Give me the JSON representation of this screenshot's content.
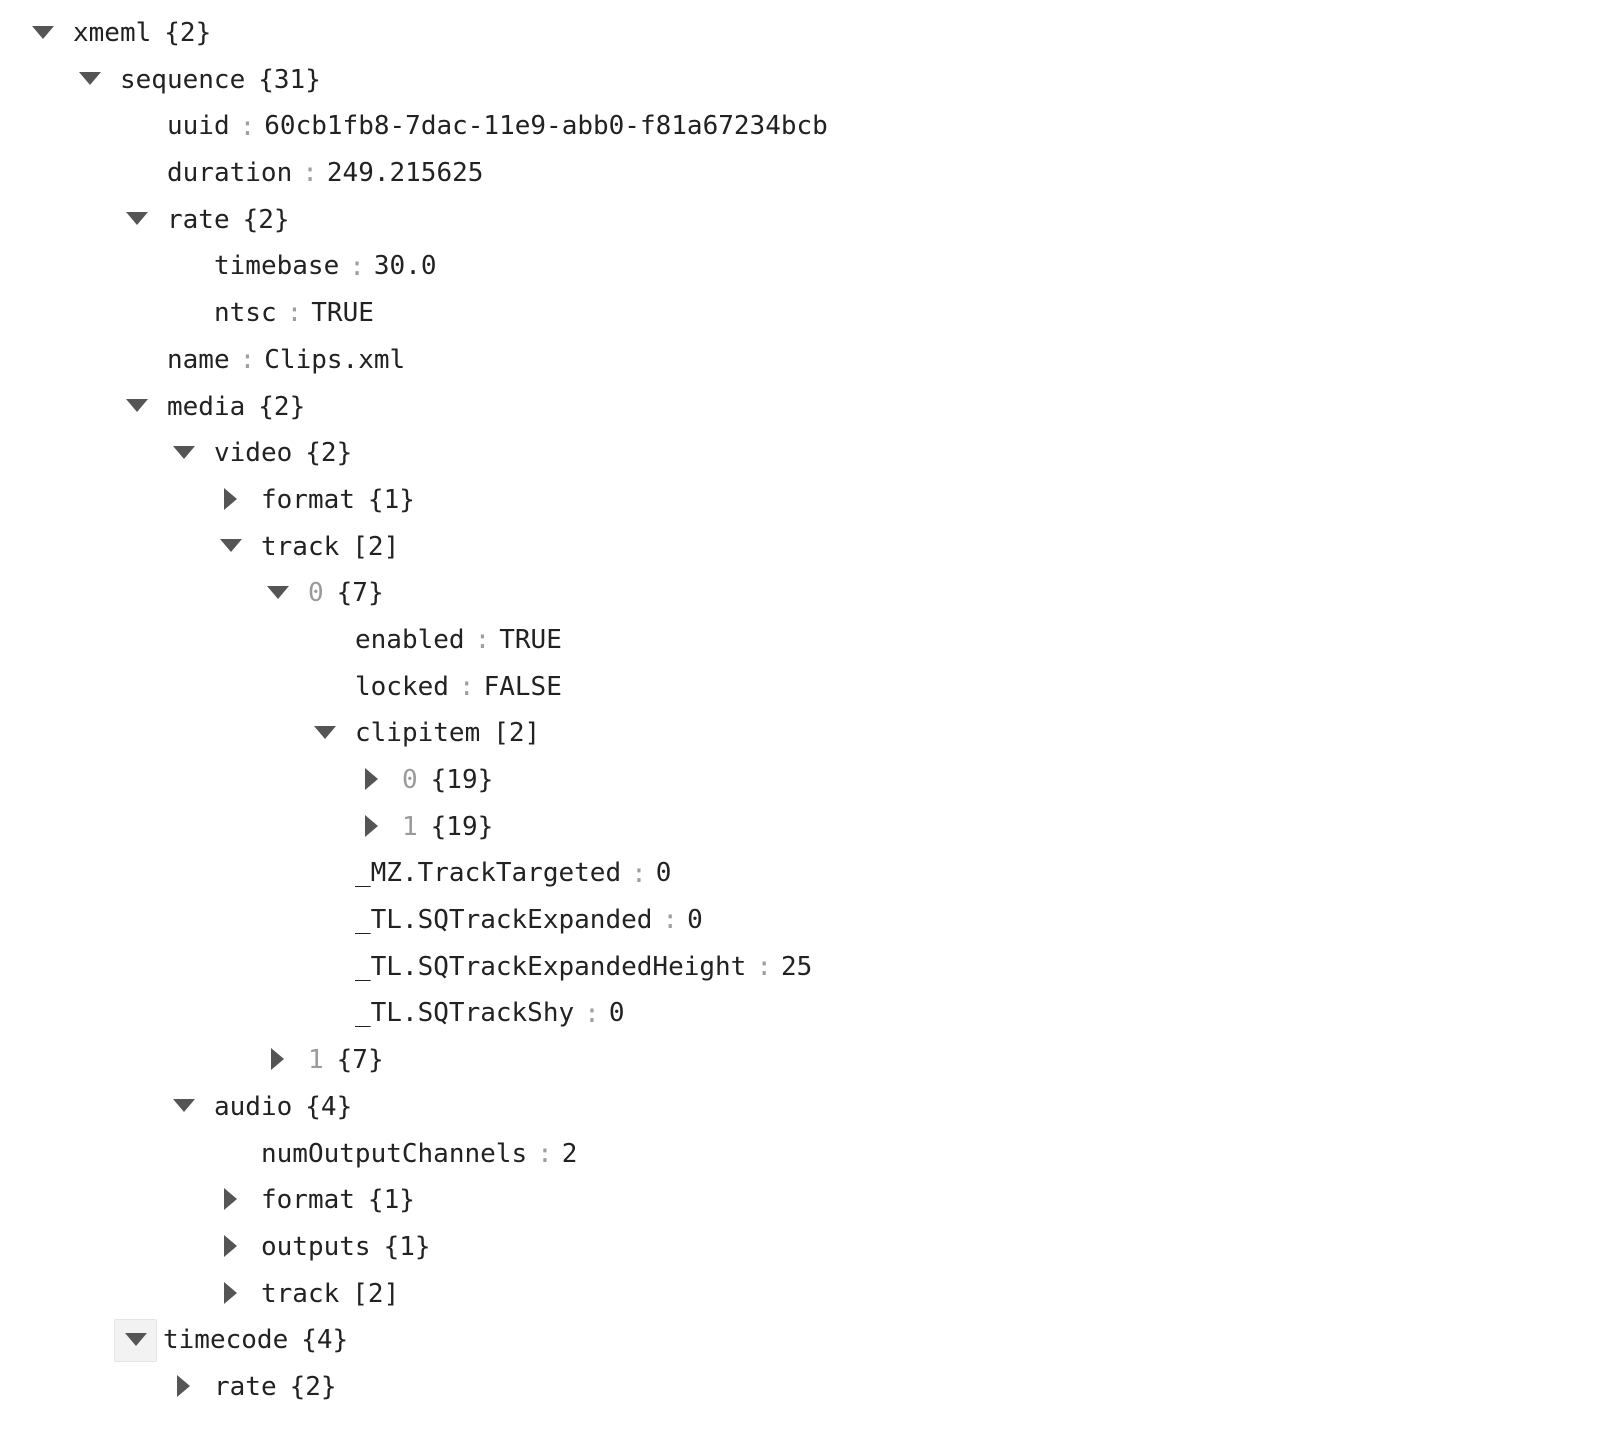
{
  "viewer": {
    "type": "json-tree",
    "root_label": "xmeml",
    "background_color": "#ffffff",
    "text_color": "#222222",
    "muted_color": "#9a9a9a",
    "arrow_color": "#555555",
    "highlight_fill": "#f2f2f2",
    "highlight_border": "#e4e4e4",
    "glyphs": {
      "expanded": "triangle-down",
      "collapsed": "triangle-right"
    }
  },
  "rows": [
    {
      "depth": 0,
      "toggle": "expanded",
      "key": "xmeml",
      "key_kind": "name",
      "count": "{2}"
    },
    {
      "depth": 1,
      "toggle": "expanded",
      "key": "sequence",
      "key_kind": "name",
      "count": "{31}"
    },
    {
      "depth": 2,
      "toggle": "none",
      "key": "uuid",
      "key_kind": "name",
      "colon": ":",
      "value": "60cb1fb8-7dac-11e9-abb0-f81a67234bcb"
    },
    {
      "depth": 2,
      "toggle": "none",
      "key": "duration",
      "key_kind": "name",
      "colon": ":",
      "value": "249.215625"
    },
    {
      "depth": 2,
      "toggle": "expanded",
      "key": "rate",
      "key_kind": "name",
      "count": "{2}"
    },
    {
      "depth": 3,
      "toggle": "none",
      "key": "timebase",
      "key_kind": "name",
      "colon": ":",
      "value": "30.0"
    },
    {
      "depth": 3,
      "toggle": "none",
      "key": "ntsc",
      "key_kind": "name",
      "colon": ":",
      "value": "TRUE"
    },
    {
      "depth": 2,
      "toggle": "none",
      "key": "name",
      "key_kind": "name",
      "colon": ":",
      "value": "Clips.xml"
    },
    {
      "depth": 2,
      "toggle": "expanded",
      "key": "media",
      "key_kind": "name",
      "count": "{2}"
    },
    {
      "depth": 3,
      "toggle": "expanded",
      "key": "video",
      "key_kind": "name",
      "count": "{2}"
    },
    {
      "depth": 4,
      "toggle": "collapsed",
      "key": "format",
      "key_kind": "name",
      "count": "{1}"
    },
    {
      "depth": 4,
      "toggle": "expanded",
      "key": "track",
      "key_kind": "name",
      "count": "[2]"
    },
    {
      "depth": 5,
      "toggle": "expanded",
      "key": "0",
      "key_kind": "index",
      "count": "{7}"
    },
    {
      "depth": 6,
      "toggle": "none",
      "key": "enabled",
      "key_kind": "name",
      "colon": ":",
      "value": "TRUE"
    },
    {
      "depth": 6,
      "toggle": "none",
      "key": "locked",
      "key_kind": "name",
      "colon": ":",
      "value": "FALSE"
    },
    {
      "depth": 6,
      "toggle": "expanded",
      "key": "clipitem",
      "key_kind": "name",
      "count": "[2]"
    },
    {
      "depth": 7,
      "toggle": "collapsed",
      "key": "0",
      "key_kind": "index",
      "count": "{19}"
    },
    {
      "depth": 7,
      "toggle": "collapsed",
      "key": "1",
      "key_kind": "index",
      "count": "{19}"
    },
    {
      "depth": 6,
      "toggle": "none",
      "key": "_MZ.TrackTargeted",
      "key_kind": "name",
      "colon": ":",
      "value": "0"
    },
    {
      "depth": 6,
      "toggle": "none",
      "key": "_TL.SQTrackExpanded",
      "key_kind": "name",
      "colon": ":",
      "value": "0"
    },
    {
      "depth": 6,
      "toggle": "none",
      "key": "_TL.SQTrackExpandedHeight",
      "key_kind": "name",
      "colon": ":",
      "value": "25"
    },
    {
      "depth": 6,
      "toggle": "none",
      "key": "_TL.SQTrackShy",
      "key_kind": "name",
      "colon": ":",
      "value": "0"
    },
    {
      "depth": 5,
      "toggle": "collapsed",
      "key": "1",
      "key_kind": "index",
      "count": "{7}"
    },
    {
      "depth": 3,
      "toggle": "expanded",
      "key": "audio",
      "key_kind": "name",
      "count": "{4}"
    },
    {
      "depth": 4,
      "toggle": "none",
      "key": "numOutputChannels",
      "key_kind": "name",
      "colon": ":",
      "value": "2"
    },
    {
      "depth": 4,
      "toggle": "collapsed",
      "key": "format",
      "key_kind": "name",
      "count": "{1}"
    },
    {
      "depth": 4,
      "toggle": "collapsed",
      "key": "outputs",
      "key_kind": "name",
      "count": "{1}"
    },
    {
      "depth": 4,
      "toggle": "collapsed",
      "key": "track",
      "key_kind": "name",
      "count": "[2]"
    },
    {
      "depth": 2,
      "toggle": "expanded",
      "key": "timecode",
      "key_kind": "name",
      "count": "{4}",
      "highlight": true
    },
    {
      "depth": 3,
      "toggle": "collapsed",
      "key": "rate",
      "key_kind": "name",
      "count": "{2}"
    }
  ]
}
